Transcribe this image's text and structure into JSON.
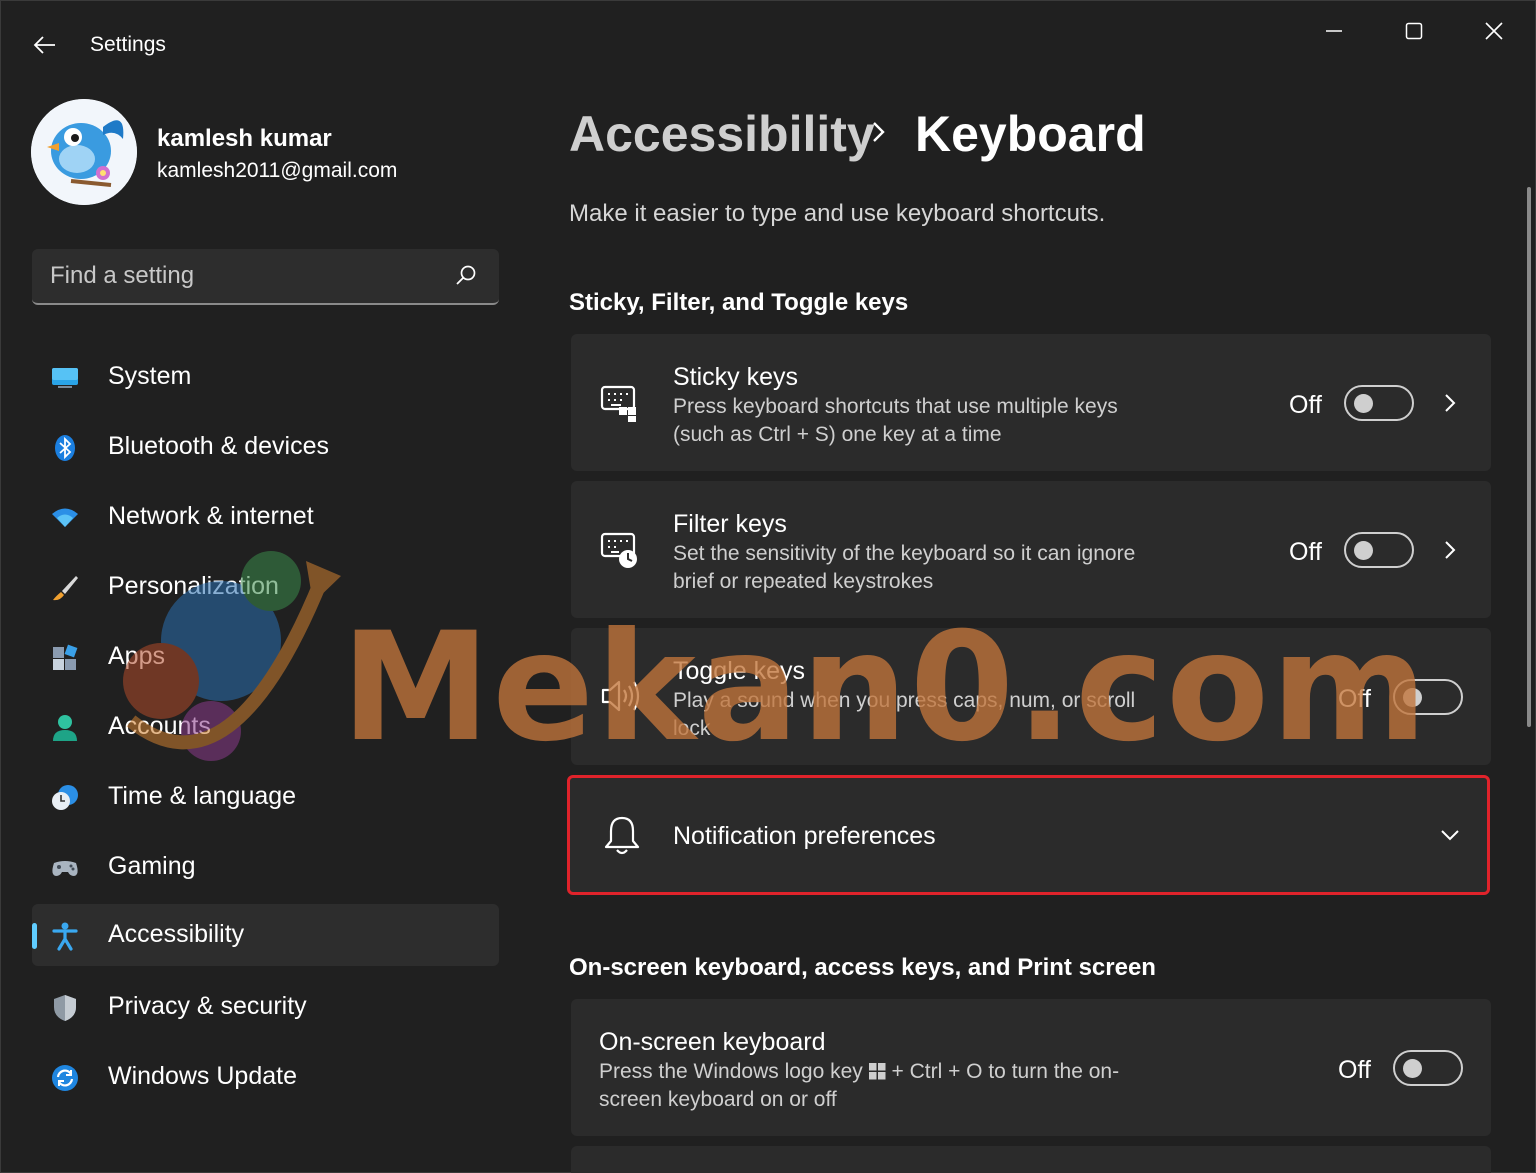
{
  "window": {
    "title": "Settings",
    "controls": [
      "minimize",
      "maximize",
      "close"
    ]
  },
  "profile": {
    "name": "kamlesh kumar",
    "email": "kamlesh2011@gmail.com"
  },
  "search": {
    "placeholder": "Find a setting"
  },
  "sidebar": {
    "items": [
      {
        "label": "System",
        "icon": "system-icon"
      },
      {
        "label": "Bluetooth & devices",
        "icon": "bluetooth-icon"
      },
      {
        "label": "Network & internet",
        "icon": "wifi-icon"
      },
      {
        "label": "Personalization",
        "icon": "brush-icon"
      },
      {
        "label": "Apps",
        "icon": "apps-icon"
      },
      {
        "label": "Accounts",
        "icon": "account-icon"
      },
      {
        "label": "Time & language",
        "icon": "globe-clock-icon"
      },
      {
        "label": "Gaming",
        "icon": "gamepad-icon"
      },
      {
        "label": "Accessibility",
        "icon": "accessibility-icon",
        "selected": true
      },
      {
        "label": "Privacy & security",
        "icon": "shield-icon"
      },
      {
        "label": "Windows Update",
        "icon": "update-icon"
      }
    ]
  },
  "main": {
    "breadcrumb": {
      "parent": "Accessibility",
      "current": "Keyboard"
    },
    "description": "Make it easier to type and use keyboard shortcuts.",
    "section1": {
      "title": "Sticky, Filter, and Toggle keys",
      "cards": [
        {
          "title": "Sticky keys",
          "desc": "Press keyboard shortcuts that use multiple keys (such as Ctrl + S) one key at a time",
          "state": "Off"
        },
        {
          "title": "Filter keys",
          "desc": "Set the sensitivity of the keyboard so it can ignore brief or repeated keystrokes",
          "state": "Off"
        },
        {
          "title": "Toggle keys",
          "desc": "Play a sound when you press caps, num, or scroll lock",
          "state": "Off"
        }
      ],
      "notification": {
        "title": "Notification preferences"
      }
    },
    "section2": {
      "title": "On-screen keyboard, access keys, and Print screen",
      "cards": [
        {
          "title": "On-screen keyboard",
          "desc_before": "Press the Windows logo key",
          "desc_after": "+ Ctrl + O to turn the on-screen keyboard on or off",
          "state": "Off"
        }
      ]
    }
  },
  "watermark": {
    "text": "Mekan0.com"
  },
  "colors": {
    "background": "#202020",
    "card": "#2b2b2b",
    "accent": "#60cdff",
    "highlight_border": "#e0232b",
    "watermark": "#c2753b"
  }
}
